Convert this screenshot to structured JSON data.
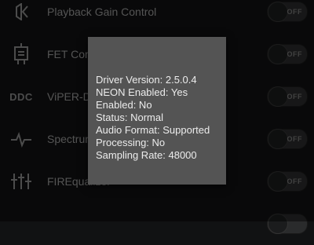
{
  "settings": {
    "items": [
      {
        "label": "Playback Gain Control",
        "icon": "speaker-gain-icon",
        "toggle": "OFF"
      },
      {
        "label": "FET Compressor",
        "icon": "fet-transistor-icon",
        "toggle": "OFF"
      },
      {
        "label": "ViPER-DDC",
        "icon": "ddc-icon",
        "icon_text": "DDC",
        "toggle": "OFF"
      },
      {
        "label": "Spectrum Extension",
        "icon": "waveform-icon",
        "toggle": "OFF"
      },
      {
        "label": "FIREqualizer",
        "icon": "equalizer-sliders-icon",
        "toggle": "OFF"
      }
    ]
  },
  "dialog": {
    "lines": [
      "Driver Version: 2.5.0.4",
      "NEON Enabled: Yes",
      "Enabled: No",
      "Status: Normal",
      "Audio Format: Supported",
      "Processing: No",
      "Sampling Rate: 48000"
    ]
  },
  "colors": {
    "background": "#111213",
    "dialog": "#545454",
    "label": "#9a9a9a"
  }
}
